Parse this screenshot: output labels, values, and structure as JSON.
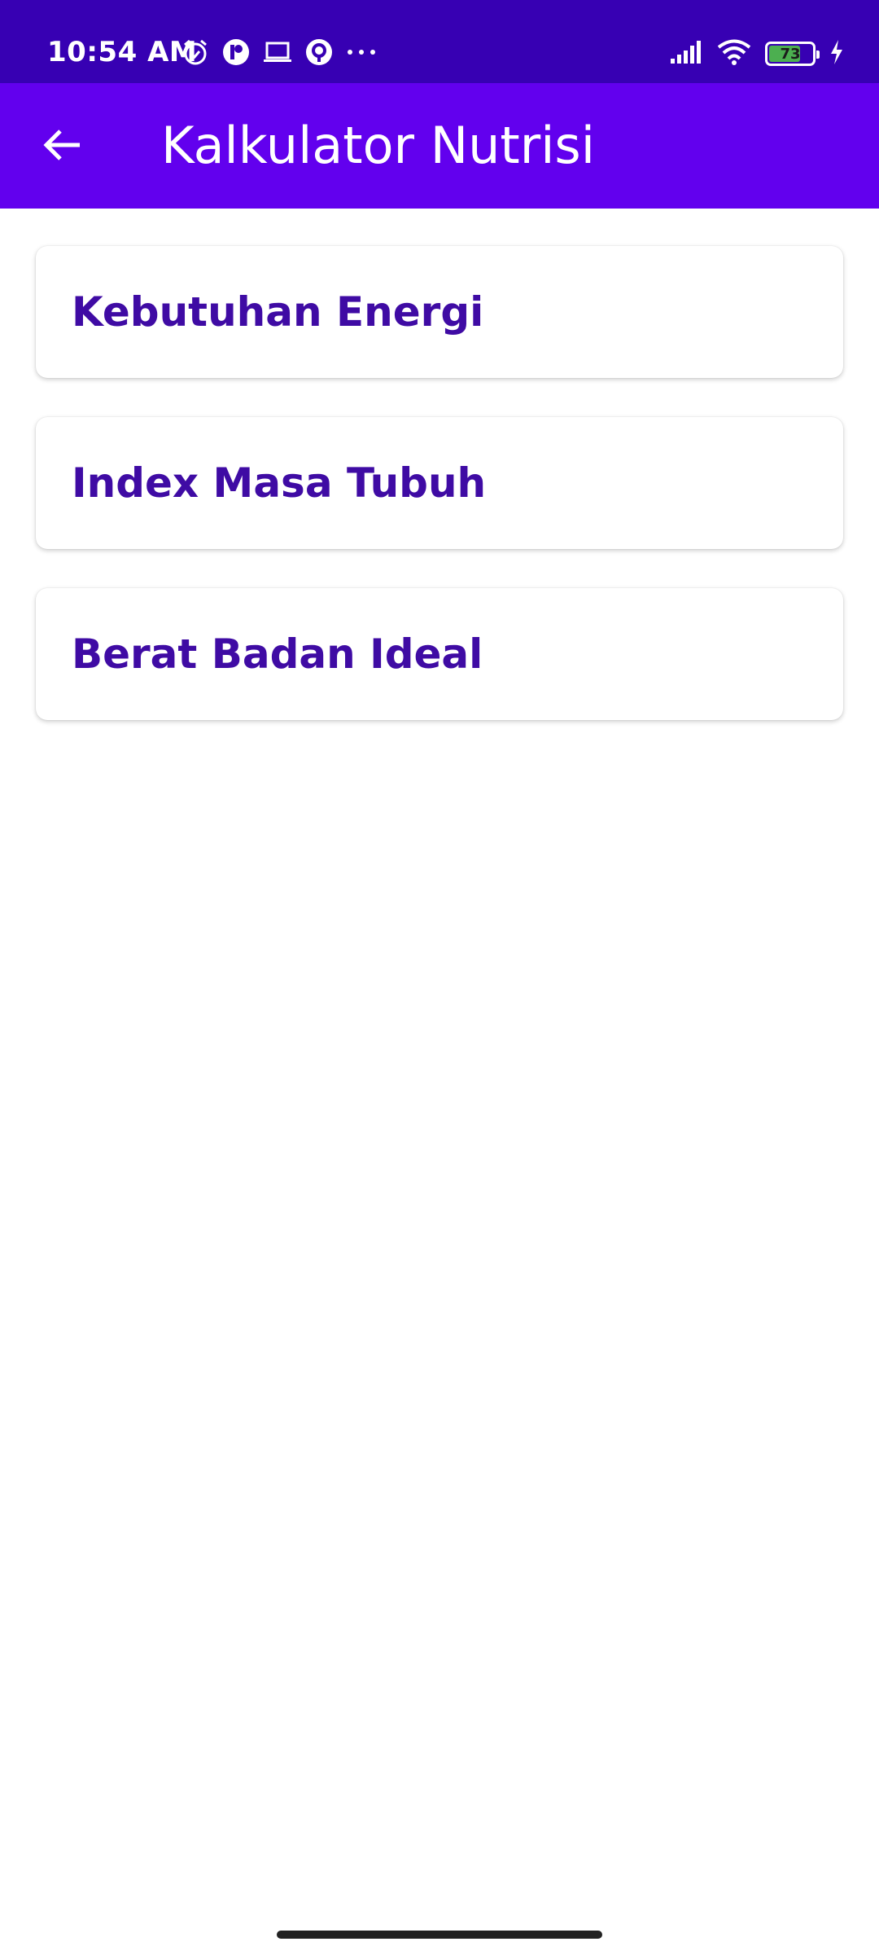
{
  "status_bar": {
    "time": "10:54 AM",
    "left_icons": [
      "alarm-icon",
      "app-notification-icon",
      "laptop-icon",
      "location-app-icon",
      "more-dots-icon"
    ],
    "right_icons": [
      "signal-icon",
      "wifi-icon",
      "battery-icon",
      "charging-icon"
    ],
    "battery_level": "73",
    "battery_fraction": 0.73,
    "background_color": "#3700b3"
  },
  "app_bar": {
    "title": "Kalkulator Nutrisi",
    "back_icon": "arrow-back-icon",
    "background_color": "#6200ee"
  },
  "menu": {
    "items": [
      {
        "label": "Kebutuhan Energi"
      },
      {
        "label": "Index Masa Tubuh"
      },
      {
        "label": "Berat Badan Ideal"
      }
    ],
    "text_color": "#3f0ba4"
  }
}
